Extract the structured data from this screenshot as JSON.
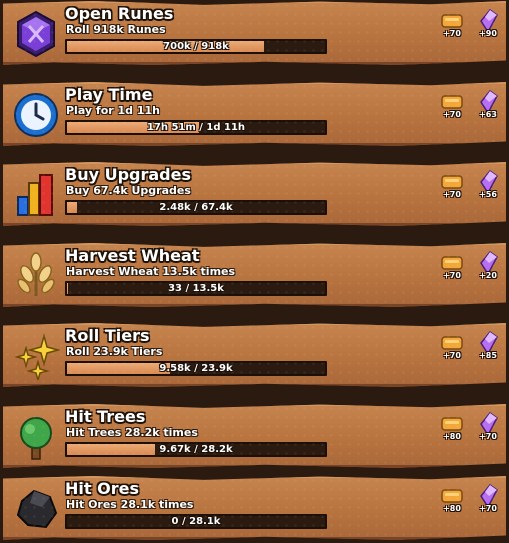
{
  "quests": [
    {
      "title": "Open Runes",
      "desc": "Roll 918k Runes",
      "progress_text": "700k / 918k",
      "progress": 0.762,
      "icon": "rune-gem-icon",
      "reward_gold": "+70",
      "reward_gem": "+90"
    },
    {
      "title": "Play Time",
      "desc": "Play for 1d 11h",
      "progress_text": "17h 51m / 1d 11h",
      "progress": 0.51,
      "icon": "clock-icon",
      "reward_gold": "+70",
      "reward_gem": "+63"
    },
    {
      "title": "Buy Upgrades",
      "desc": "Buy 67.4k Upgrades",
      "progress_text": "2.48k / 67.4k",
      "progress": 0.037,
      "icon": "bar-chart-icon",
      "reward_gold": "+70",
      "reward_gem": "+56"
    },
    {
      "title": "Harvest Wheat",
      "desc": "Harvest Wheat 13.5k times",
      "progress_text": "33 / 13.5k",
      "progress": 0.002,
      "icon": "wheat-icon",
      "reward_gold": "+70",
      "reward_gem": "+20"
    },
    {
      "title": "Roll Tiers",
      "desc": "Roll 23.9k Tiers",
      "progress_text": "9.58k / 23.9k",
      "progress": 0.401,
      "icon": "sparkles-icon",
      "reward_gold": "+70",
      "reward_gem": "+85"
    },
    {
      "title": "Hit Trees",
      "desc": "Hit Trees 28.2k times",
      "progress_text": "9.67k / 28.2k",
      "progress": 0.343,
      "icon": "tree-icon",
      "reward_gold": "+80",
      "reward_gem": "+70"
    },
    {
      "title": "Hit Ores",
      "desc": "Hit Ores 28.1k times",
      "progress_text": "0 / 28.1k",
      "progress": 0.0,
      "icon": "ore-rock-icon",
      "reward_gold": "+80",
      "reward_gem": "+70"
    }
  ],
  "colors": {
    "panel": "#b8743f",
    "bar_fill": "#e39a62",
    "bar_bg": "#2a1a10",
    "gold": "#f3a73a",
    "gem": "#b76ef0"
  }
}
